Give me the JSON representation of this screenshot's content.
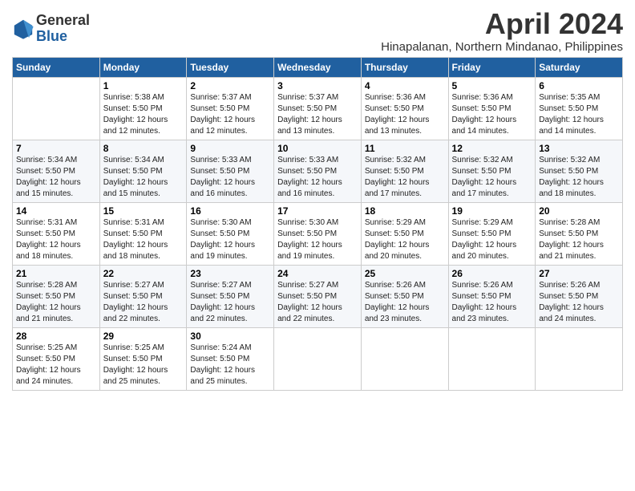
{
  "header": {
    "logo_general": "General",
    "logo_blue": "Blue",
    "month_title": "April 2024",
    "location": "Hinapalanan, Northern Mindanao, Philippines"
  },
  "days_of_week": [
    "Sunday",
    "Monday",
    "Tuesday",
    "Wednesday",
    "Thursday",
    "Friday",
    "Saturday"
  ],
  "weeks": [
    [
      {
        "day": "",
        "info": ""
      },
      {
        "day": "1",
        "info": "Sunrise: 5:38 AM\nSunset: 5:50 PM\nDaylight: 12 hours\nand 12 minutes."
      },
      {
        "day": "2",
        "info": "Sunrise: 5:37 AM\nSunset: 5:50 PM\nDaylight: 12 hours\nand 12 minutes."
      },
      {
        "day": "3",
        "info": "Sunrise: 5:37 AM\nSunset: 5:50 PM\nDaylight: 12 hours\nand 13 minutes."
      },
      {
        "day": "4",
        "info": "Sunrise: 5:36 AM\nSunset: 5:50 PM\nDaylight: 12 hours\nand 13 minutes."
      },
      {
        "day": "5",
        "info": "Sunrise: 5:36 AM\nSunset: 5:50 PM\nDaylight: 12 hours\nand 14 minutes."
      },
      {
        "day": "6",
        "info": "Sunrise: 5:35 AM\nSunset: 5:50 PM\nDaylight: 12 hours\nand 14 minutes."
      }
    ],
    [
      {
        "day": "7",
        "info": "Sunrise: 5:34 AM\nSunset: 5:50 PM\nDaylight: 12 hours\nand 15 minutes."
      },
      {
        "day": "8",
        "info": "Sunrise: 5:34 AM\nSunset: 5:50 PM\nDaylight: 12 hours\nand 15 minutes."
      },
      {
        "day": "9",
        "info": "Sunrise: 5:33 AM\nSunset: 5:50 PM\nDaylight: 12 hours\nand 16 minutes."
      },
      {
        "day": "10",
        "info": "Sunrise: 5:33 AM\nSunset: 5:50 PM\nDaylight: 12 hours\nand 16 minutes."
      },
      {
        "day": "11",
        "info": "Sunrise: 5:32 AM\nSunset: 5:50 PM\nDaylight: 12 hours\nand 17 minutes."
      },
      {
        "day": "12",
        "info": "Sunrise: 5:32 AM\nSunset: 5:50 PM\nDaylight: 12 hours\nand 17 minutes."
      },
      {
        "day": "13",
        "info": "Sunrise: 5:32 AM\nSunset: 5:50 PM\nDaylight: 12 hours\nand 18 minutes."
      }
    ],
    [
      {
        "day": "14",
        "info": "Sunrise: 5:31 AM\nSunset: 5:50 PM\nDaylight: 12 hours\nand 18 minutes."
      },
      {
        "day": "15",
        "info": "Sunrise: 5:31 AM\nSunset: 5:50 PM\nDaylight: 12 hours\nand 18 minutes."
      },
      {
        "day": "16",
        "info": "Sunrise: 5:30 AM\nSunset: 5:50 PM\nDaylight: 12 hours\nand 19 minutes."
      },
      {
        "day": "17",
        "info": "Sunrise: 5:30 AM\nSunset: 5:50 PM\nDaylight: 12 hours\nand 19 minutes."
      },
      {
        "day": "18",
        "info": "Sunrise: 5:29 AM\nSunset: 5:50 PM\nDaylight: 12 hours\nand 20 minutes."
      },
      {
        "day": "19",
        "info": "Sunrise: 5:29 AM\nSunset: 5:50 PM\nDaylight: 12 hours\nand 20 minutes."
      },
      {
        "day": "20",
        "info": "Sunrise: 5:28 AM\nSunset: 5:50 PM\nDaylight: 12 hours\nand 21 minutes."
      }
    ],
    [
      {
        "day": "21",
        "info": "Sunrise: 5:28 AM\nSunset: 5:50 PM\nDaylight: 12 hours\nand 21 minutes."
      },
      {
        "day": "22",
        "info": "Sunrise: 5:27 AM\nSunset: 5:50 PM\nDaylight: 12 hours\nand 22 minutes."
      },
      {
        "day": "23",
        "info": "Sunrise: 5:27 AM\nSunset: 5:50 PM\nDaylight: 12 hours\nand 22 minutes."
      },
      {
        "day": "24",
        "info": "Sunrise: 5:27 AM\nSunset: 5:50 PM\nDaylight: 12 hours\nand 22 minutes."
      },
      {
        "day": "25",
        "info": "Sunrise: 5:26 AM\nSunset: 5:50 PM\nDaylight: 12 hours\nand 23 minutes."
      },
      {
        "day": "26",
        "info": "Sunrise: 5:26 AM\nSunset: 5:50 PM\nDaylight: 12 hours\nand 23 minutes."
      },
      {
        "day": "27",
        "info": "Sunrise: 5:26 AM\nSunset: 5:50 PM\nDaylight: 12 hours\nand 24 minutes."
      }
    ],
    [
      {
        "day": "28",
        "info": "Sunrise: 5:25 AM\nSunset: 5:50 PM\nDaylight: 12 hours\nand 24 minutes."
      },
      {
        "day": "29",
        "info": "Sunrise: 5:25 AM\nSunset: 5:50 PM\nDaylight: 12 hours\nand 25 minutes."
      },
      {
        "day": "30",
        "info": "Sunrise: 5:24 AM\nSunset: 5:50 PM\nDaylight: 12 hours\nand 25 minutes."
      },
      {
        "day": "",
        "info": ""
      },
      {
        "day": "",
        "info": ""
      },
      {
        "day": "",
        "info": ""
      },
      {
        "day": "",
        "info": ""
      }
    ]
  ]
}
